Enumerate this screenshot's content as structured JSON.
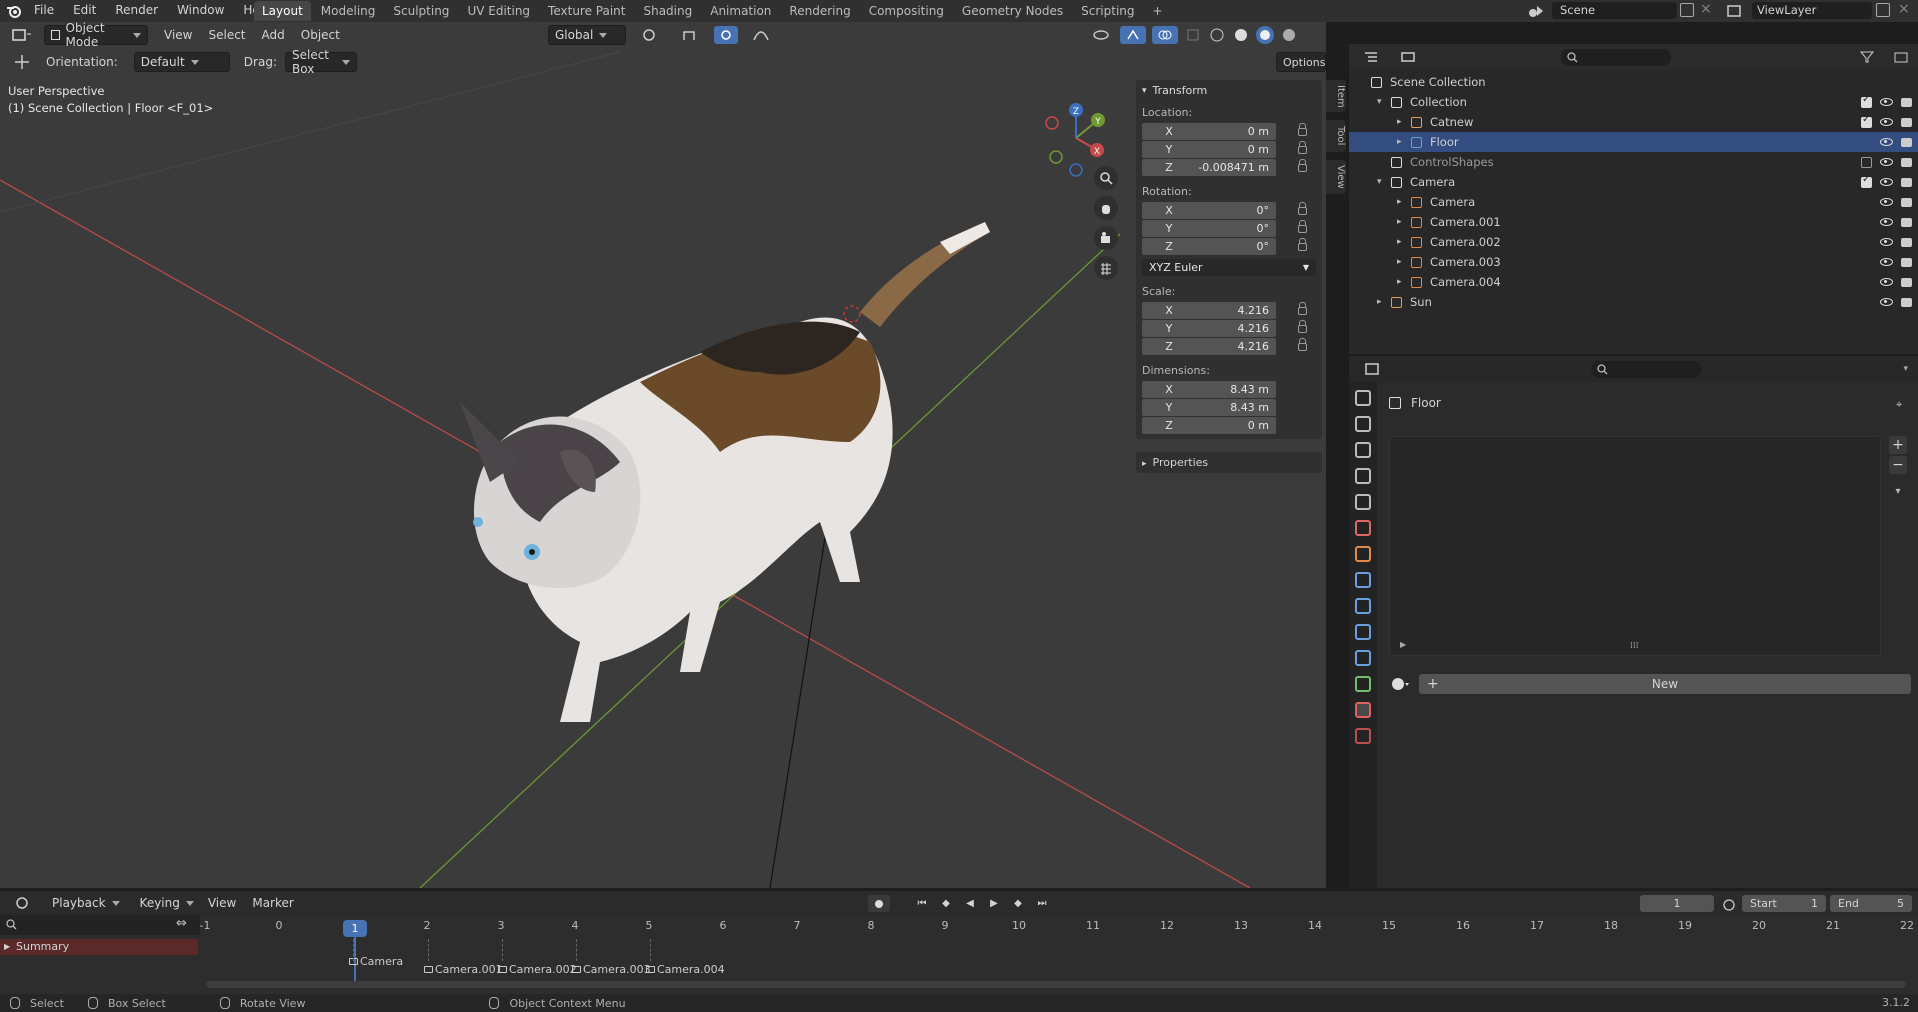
{
  "top_menu": [
    "File",
    "Edit",
    "Render",
    "Window",
    "Help"
  ],
  "workspaces": [
    "Layout",
    "Modeling",
    "Sculpting",
    "UV Editing",
    "Texture Paint",
    "Shading",
    "Animation",
    "Rendering",
    "Compositing",
    "Geometry Nodes",
    "Scripting"
  ],
  "active_workspace": "Layout",
  "scene_name": "Scene",
  "view_layer": "ViewLayer",
  "viewport_header": {
    "mode": "Object Mode",
    "menus": [
      "View",
      "Select",
      "Add",
      "Object"
    ],
    "transform_orientation": "Global",
    "orientation_label": "Orientation:",
    "orientation_value": "Default",
    "drag_label": "Drag:",
    "drag_value": "Select Box",
    "options": "Options"
  },
  "viewport_info": {
    "line1": "User Perspective",
    "line2": "(1) Scene Collection | Floor <F_01>"
  },
  "gizmo": {
    "x": "X",
    "y": "Y",
    "z": "Z"
  },
  "side_tabs": [
    "Item",
    "Tool",
    "View"
  ],
  "npanel": {
    "transform": "Transform",
    "location_label": "Location:",
    "location": [
      {
        "axis": "X",
        "value": "0 m"
      },
      {
        "axis": "Y",
        "value": "0 m"
      },
      {
        "axis": "Z",
        "value": "-0.008471 m"
      }
    ],
    "rotation_label": "Rotation:",
    "rotation": [
      {
        "axis": "X",
        "value": "0°"
      },
      {
        "axis": "Y",
        "value": "0°"
      },
      {
        "axis": "Z",
        "value": "0°"
      }
    ],
    "rotation_mode": "XYZ Euler",
    "scale_label": "Scale:",
    "scale": [
      {
        "axis": "X",
        "value": "4.216"
      },
      {
        "axis": "Y",
        "value": "4.216"
      },
      {
        "axis": "Z",
        "value": "4.216"
      }
    ],
    "dimensions_label": "Dimensions:",
    "dimensions": [
      {
        "axis": "X",
        "value": "8.43 m"
      },
      {
        "axis": "Y",
        "value": "8.43 m"
      },
      {
        "axis": "Z",
        "value": "0 m"
      }
    ],
    "properties": "Properties"
  },
  "outliner": {
    "rows": [
      {
        "label": "Scene Collection",
        "indent": 0,
        "selected": false
      },
      {
        "label": "Collection",
        "indent": 1,
        "selected": false
      },
      {
        "label": "Catnew",
        "indent": 2,
        "selected": false
      },
      {
        "label": "Floor",
        "indent": 2,
        "selected": true
      },
      {
        "label": "ControlShapes",
        "indent": 1,
        "selected": false
      },
      {
        "label": "Camera",
        "indent": 1,
        "selected": false
      },
      {
        "label": "Camera",
        "indent": 2,
        "selected": false
      },
      {
        "label": "Camera.001",
        "indent": 2,
        "selected": false
      },
      {
        "label": "Camera.002",
        "indent": 2,
        "selected": false
      },
      {
        "label": "Camera.003",
        "indent": 2,
        "selected": false
      },
      {
        "label": "Camera.004",
        "indent": 2,
        "selected": false
      },
      {
        "label": "Sun",
        "indent": 1,
        "selected": false
      }
    ]
  },
  "properties_editor": {
    "object_name": "Floor",
    "new_button": "New"
  },
  "timeline": {
    "menus": [
      "Playback",
      "Keying",
      "View",
      "Marker"
    ],
    "current_frame": "1",
    "start_label": "Start",
    "start": "1",
    "end_label": "End",
    "end": "5",
    "ticks": [
      "-1",
      "0",
      "1",
      "2",
      "3",
      "4",
      "5",
      "6",
      "7",
      "8",
      "9",
      "10",
      "11",
      "12",
      "13",
      "14",
      "15",
      "16",
      "17",
      "18",
      "19",
      "20",
      "21",
      "22"
    ],
    "summary": "Summary",
    "markers": [
      "Camera",
      "Camera.001",
      "Camera.002",
      "Camera.003",
      "Camera.004"
    ]
  },
  "statusbar": {
    "items": [
      "Select",
      "Box Select",
      "Rotate View",
      "Object Context Menu"
    ],
    "version": "3.1.2"
  },
  "colors": {
    "accent_blue": "#4772b3",
    "selection": "#334d80",
    "x_axis": "#c54b4b",
    "y_axis": "#6f9a32",
    "z_axis": "#3b6fc0"
  }
}
